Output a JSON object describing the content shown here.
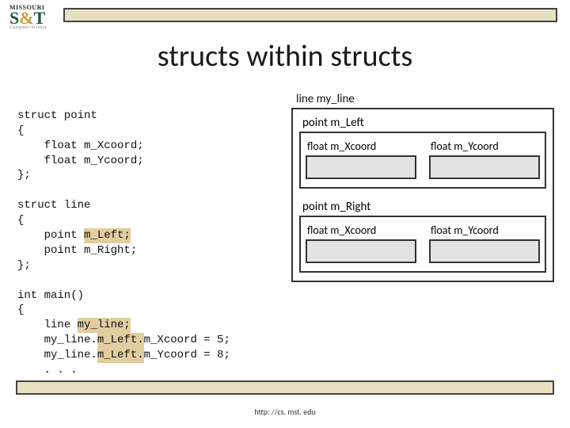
{
  "logo": {
    "top": "MISSOURI",
    "main_s": "S",
    "main_amp": "&",
    "main_t": "T",
    "sub": "Computer Science"
  },
  "title": "structs within structs",
  "code": {
    "l1": "struct point",
    "l2": "{",
    "l3": "    float m_Xcoord;",
    "l4": "    float m_Ycoord;",
    "l5": "};",
    "l6": "",
    "l7": "struct line",
    "l8": "{",
    "l9a": "    point ",
    "l9b": "m_Left;",
    "l10": "    point m_Right;",
    "l11": "};",
    "l12": "",
    "l13": "int main()",
    "l14": "{",
    "l15a": "    line ",
    "l15b": "my_line;",
    "l16a": "    my_line.",
    "l16b": "m_Left.",
    "l16c": "m_Xcoord = 5;",
    "l17a": "    my_line.",
    "l17b": "m_Left.",
    "l17c": "m_Ycoord = 8;",
    "l18": "    . . ."
  },
  "diagram": {
    "outer_label": "line my_line",
    "left_label": "point m_Left",
    "right_label": "point m_Right",
    "xcoord": "float m_Xcoord",
    "ycoord": "float m_Ycoord"
  },
  "footer": "http: //cs. mst. edu"
}
